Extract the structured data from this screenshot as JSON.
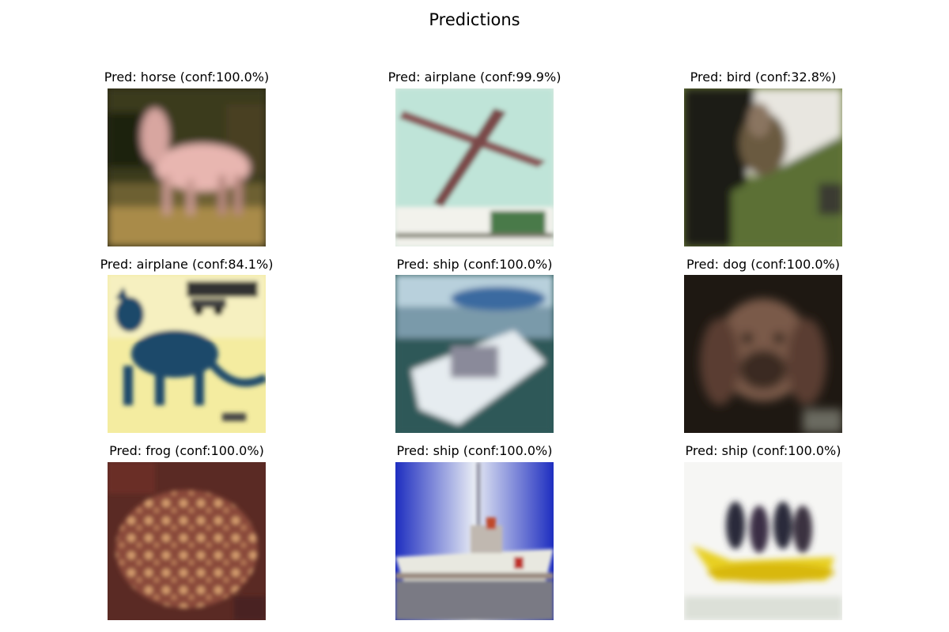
{
  "figure": {
    "title": "Predictions"
  },
  "panels": [
    {
      "title": "Pred: horse (conf:100.0%)",
      "subject": "horse"
    },
    {
      "title": "Pred: airplane (conf:99.9%)",
      "subject": "airplane"
    },
    {
      "title": "Pred: bird (conf:32.8%)",
      "subject": "dog-on-grass"
    },
    {
      "title": "Pred: airplane (conf:84.1%)",
      "subject": "cat-on-yellow"
    },
    {
      "title": "Pred: ship (conf:100.0%)",
      "subject": "motorboat"
    },
    {
      "title": "Pred: dog (conf:100.0%)",
      "subject": "dog"
    },
    {
      "title": "Pred: frog (conf:100.0%)",
      "subject": "frog"
    },
    {
      "title": "Pred: ship (conf:100.0%)",
      "subject": "ship"
    },
    {
      "title": "Pred: ship (conf:100.0%)",
      "subject": "banana-boat"
    }
  ]
}
